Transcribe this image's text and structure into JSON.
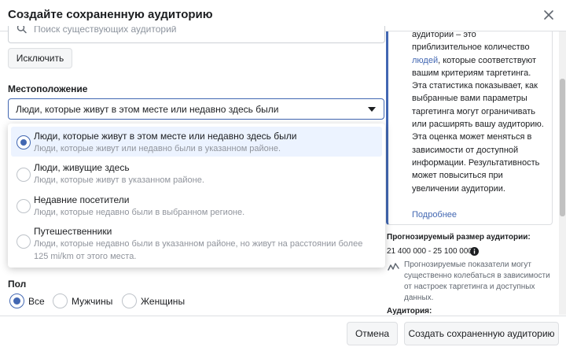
{
  "header": {
    "title": "Создайте сохраненную аудиторию"
  },
  "search": {
    "placeholder": "Поиск существующих аудиторий"
  },
  "exclude_label": "Исключить",
  "location": {
    "label": "Местоположение",
    "selected": "Люди, которые живут в этом месте или недавно здесь были",
    "options": [
      {
        "title": "Люди, которые живут в этом месте или недавно здесь были",
        "desc": "Люди, которые живут или недавно были в указанном районе.",
        "checked": true
      },
      {
        "title": "Люди, живущие здесь",
        "desc": "Люди, которые живут в указанном районе.",
        "checked": false
      },
      {
        "title": "Недавние посетители",
        "desc": "Люди, которые недавно были в выбранном регионе.",
        "checked": false
      },
      {
        "title": "Путешественники",
        "desc": "Люди, которые недавно были в указанном районе, но живут на расстоянии более 125 mi/km от этого места.",
        "checked": false
      }
    ]
  },
  "sex": {
    "label": "Пол",
    "options": [
      "Все",
      "Мужчины",
      "Женщины"
    ]
  },
  "info": {
    "line1": "аудитории – это приблизительное количество",
    "link": "людей",
    "line2": ", которые соответствуют вашим критериям таргетинга. Эта статистика показывает, как выбранные вами параметры таргетинга могут ограничивать или расширять вашу аудиторию. Эта оценка может меняться в зависимости от доступной информации. Результативность может повыситься при увеличении аудитории.",
    "more": "Подробнее"
  },
  "estimate": {
    "title": "Прогнозируемый размер аудитории:",
    "range": "21 400 000 - 25 100 000",
    "note": "Прогнозируемые показатели могут существенно колебаться в зависимости от настроек таргетинга и доступных данных."
  },
  "audience_title": "Аудитория:",
  "footer": {
    "cancel": "Отмена",
    "create": "Создать сохраненную аудиторию"
  },
  "colors": {
    "accent": "#4267b2",
    "selected_bg": "#ecf3ff",
    "muted": "#90949c"
  }
}
